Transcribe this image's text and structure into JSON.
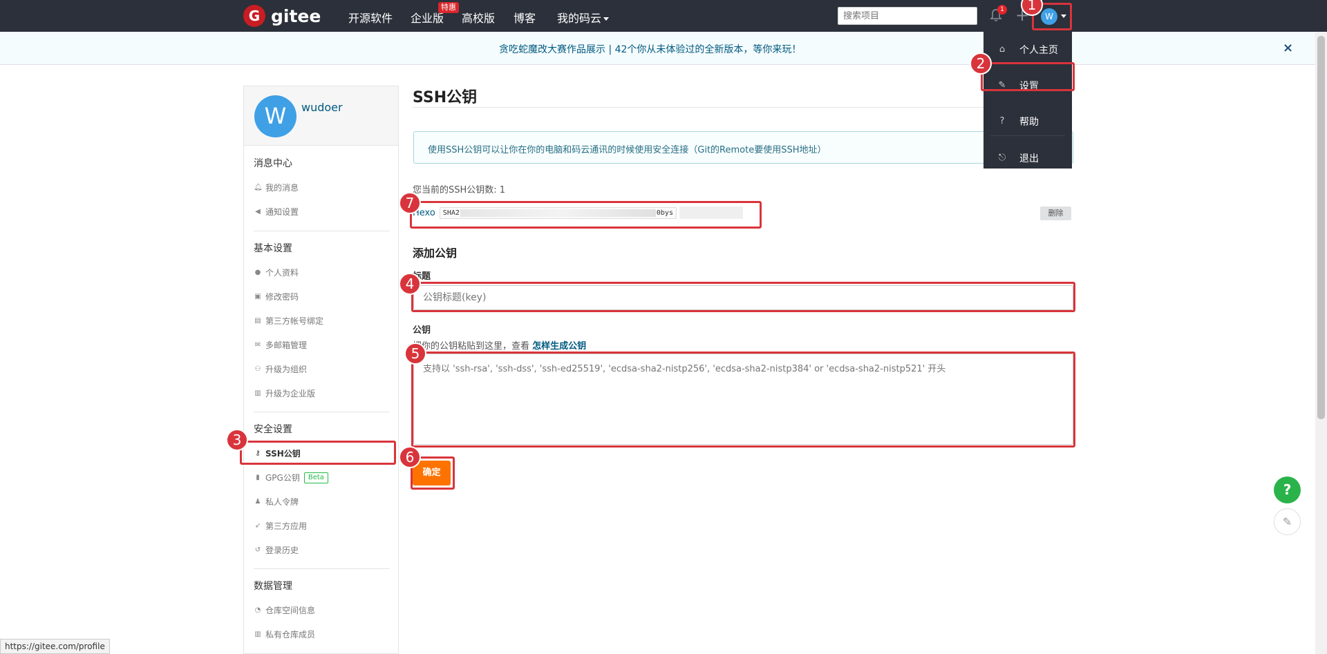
{
  "nav": {
    "logo_letter": "G",
    "logo_text": "gitee",
    "links": [
      "开源软件",
      "企业版",
      "高校版",
      "博客",
      "我的码云"
    ],
    "hot_badge": "特惠",
    "search_placeholder": "搜索项目",
    "notification_count": "1",
    "plus": "+",
    "avatar_letter": "W"
  },
  "notice": {
    "text": "贪吃蛇魔改大赛作品展示 | 42个你从未体验过的全新版本，等你来玩！",
    "close": "×"
  },
  "dropdown": {
    "items": [
      "个人主页",
      "设置",
      "帮助",
      "退出"
    ]
  },
  "sidebar": {
    "avatar_letter": "W",
    "username": "wudoer",
    "sections": {
      "messages": "消息中心",
      "basic": "基本设置",
      "security": "安全设置",
      "data": "数据管理"
    },
    "messages_items": [
      "我的消息",
      "通知设置"
    ],
    "basic_items": [
      "个人资料",
      "修改密码",
      "第三方帐号绑定",
      "多邮箱管理",
      "升级为组织",
      "升级为企业版"
    ],
    "security_items": [
      "SSH公钥",
      "GPG公钥",
      "私人令牌",
      "第三方应用",
      "登录历史"
    ],
    "beta_label": "Beta",
    "data_items": [
      "仓库空间信息",
      "私有仓库成员"
    ]
  },
  "main": {
    "title": "SSH公钥",
    "info": "使用SSH公钥可以让你在你的电脑和码云通讯的时候使用安全连接（Git的Remote要使用SSH地址）",
    "count_text": "您当前的SSH公钥数: 1",
    "key_name": "Hexo",
    "key_prefix": "SHA2",
    "key_suffix": "0bys",
    "delete_label": "删除",
    "add_title": "添加公钥",
    "title_label": "标题",
    "title_placeholder": "公钥标题(key)",
    "key_label": "公钥",
    "hint_text": "把你的公钥粘贴到这里，查看 ",
    "hint_link": "怎样生成公钥",
    "key_placeholder": "支持以 'ssh-rsa', 'ssh-dss', 'ssh-ed25519', 'ecdsa-sha2-nistp256', 'ecdsa-sha2-nistp384' or 'ecdsa-sha2-nistp521' 开头",
    "confirm_label": "确定"
  },
  "annotations": [
    "1",
    "2",
    "3",
    "4",
    "5",
    "6",
    "7"
  ],
  "floating": {
    "help": "?",
    "edit": "✎"
  },
  "status_url": "https://gitee.com/profile",
  "colors": {
    "nav_bg": "#2b303a",
    "accent": "#005980",
    "annotation": "#d9343b",
    "confirm": "#fe7300",
    "logo": "#c71d23"
  }
}
